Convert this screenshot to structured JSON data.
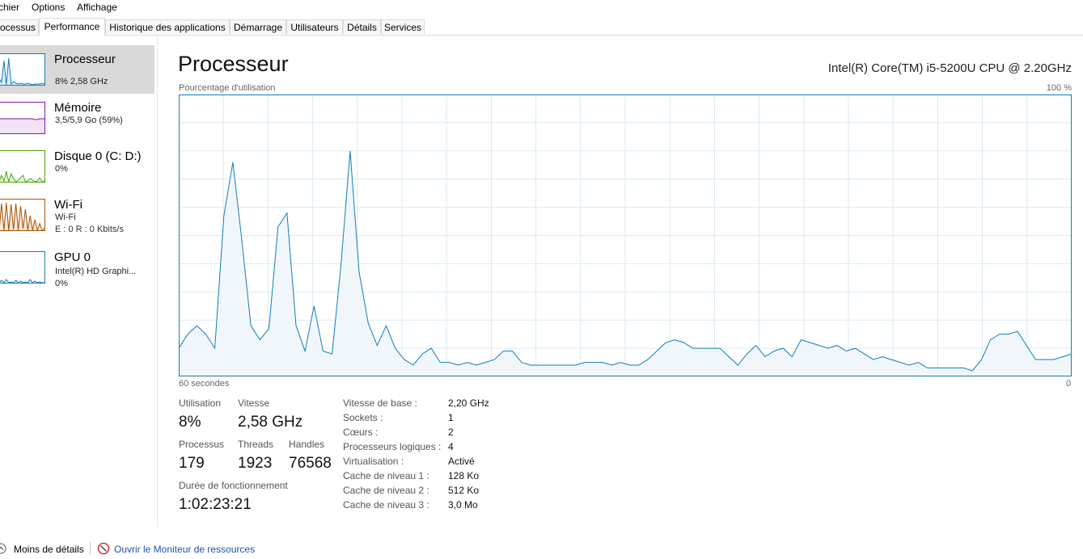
{
  "menu": [
    "chier",
    "Options",
    "Affichage"
  ],
  "tabs": [
    {
      "label": "ocessus"
    },
    {
      "label": "Performance"
    },
    {
      "label": "Historique des applications"
    },
    {
      "label": "Démarrage"
    },
    {
      "label": "Utilisateurs"
    },
    {
      "label": "Détails"
    },
    {
      "label": "Services"
    }
  ],
  "sidebar": [
    {
      "title": "Processeur",
      "sub1": "8% 2,58 GHz",
      "sub2": "",
      "color": "#117dbb",
      "icon": "cpu-mini-graph"
    },
    {
      "title": "Mémoire",
      "sub1": "3,5/5,9 Go (59%)",
      "sub2": "",
      "color": "#8b12ae",
      "icon": "memory-mini-graph"
    },
    {
      "title": "Disque 0 (C: D:)",
      "sub1": "0%",
      "sub2": "",
      "color": "#4da60c",
      "icon": "disk-mini-graph"
    },
    {
      "title": "Wi-Fi",
      "sub1": "Wi-Fi",
      "sub2": "E : 0 R : 0 Kbits/s",
      "color": "#a74f01",
      "icon": "wifi-mini-graph"
    },
    {
      "title": "GPU 0",
      "sub1": "Intel(R) HD Graphi...",
      "sub2": "0%",
      "color": "#117dbb",
      "icon": "gpu-mini-graph"
    }
  ],
  "main": {
    "title": "Processeur",
    "cpu_name": "Intel(R) Core(TM) i5-5200U CPU @ 2.20GHz",
    "graph_label": "Pourcentage d'utilisation",
    "graph_max": "100 %",
    "graph_time_left": "60 secondes",
    "graph_time_right": "0"
  },
  "chart_data": {
    "type": "area",
    "title": "",
    "xlabel": "",
    "ylabel": "Pourcentage d'utilisation",
    "xlim": [
      60,
      0
    ],
    "ylim": [
      0,
      100
    ],
    "grid": true,
    "series": [
      {
        "values": [
          10,
          15,
          18,
          15,
          10,
          57,
          76,
          48,
          18,
          13,
          17,
          53,
          58,
          18,
          9,
          25,
          9,
          8,
          40,
          80,
          37,
          19,
          11,
          18,
          10,
          6,
          4,
          8,
          10,
          5,
          5,
          4,
          5,
          4,
          5,
          6,
          9,
          9,
          5,
          4,
          4,
          4,
          4,
          4,
          4,
          5,
          5,
          5,
          4,
          5,
          4,
          4,
          6,
          9,
          12,
          13,
          12,
          10,
          10,
          10,
          10,
          7,
          4,
          8,
          11,
          7,
          9,
          10,
          7,
          13,
          12,
          11,
          10,
          11,
          9,
          10,
          8,
          6,
          7,
          6,
          5,
          4,
          5,
          3,
          3,
          3,
          3,
          3,
          2,
          6,
          13,
          15,
          15,
          16,
          11,
          6,
          6,
          6,
          7,
          8
        ]
      }
    ]
  },
  "stats": {
    "utilisation_label": "Utilisation",
    "utilisation_value": "8%",
    "vitesse_label": "Vitesse",
    "vitesse_value": "2,58 GHz",
    "processus_label": "Processus",
    "processus_value": "179",
    "threads_label": "Threads",
    "threads_value": "1923",
    "handles_label": "Handles",
    "handles_value": "76568",
    "uptime_label": "Durée de fonctionnement",
    "uptime_value": "1:02:23:21"
  },
  "specs": [
    {
      "key": "Vitesse de base :",
      "value": "2,20 GHz"
    },
    {
      "key": "Sockets :",
      "value": "1"
    },
    {
      "key": "Cœurs :",
      "value": "2"
    },
    {
      "key": "Processeurs logiques :",
      "value": "4"
    },
    {
      "key": "Virtualisation :",
      "value": "Activé"
    },
    {
      "key": "Cache de niveau 1 :",
      "value": "128 Ko"
    },
    {
      "key": "Cache de niveau 2 :",
      "value": "512 Ko"
    },
    {
      "key": "Cache de niveau 3 :",
      "value": "3,0 Mo"
    }
  ],
  "bottom": {
    "fewer_details": "Moins de détails",
    "resource_monitor": "Ouvrir le Moniteur de ressources"
  }
}
